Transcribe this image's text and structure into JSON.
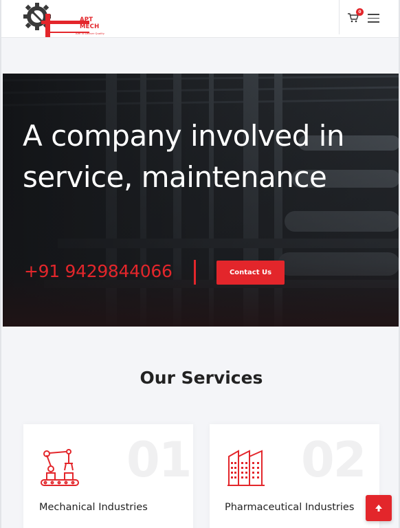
{
  "brand": {
    "name": "APT MECH",
    "tagline": "Aim To Deliver Quality"
  },
  "header": {
    "cart_count": "0",
    "cart_icon": "cart-icon",
    "menu_icon": "hamburger-menu-icon"
  },
  "hero": {
    "title": "A company involved in service, maintenance",
    "phone": "+91 9429844066",
    "contact_label": "Contact Us"
  },
  "services": {
    "heading": "Our Services",
    "items": [
      {
        "number": "01",
        "label": "Mechanical Industries",
        "icon": "robotic-arm-icon"
      },
      {
        "number": "02",
        "label": "Pharmaceutical Industries",
        "icon": "factory-building-icon"
      }
    ]
  },
  "scroll_top_icon": "arrow-up-icon",
  "colors": {
    "accent": "#e3262b",
    "text_dark": "#222222",
    "page_bg": "#f4f5f8"
  }
}
